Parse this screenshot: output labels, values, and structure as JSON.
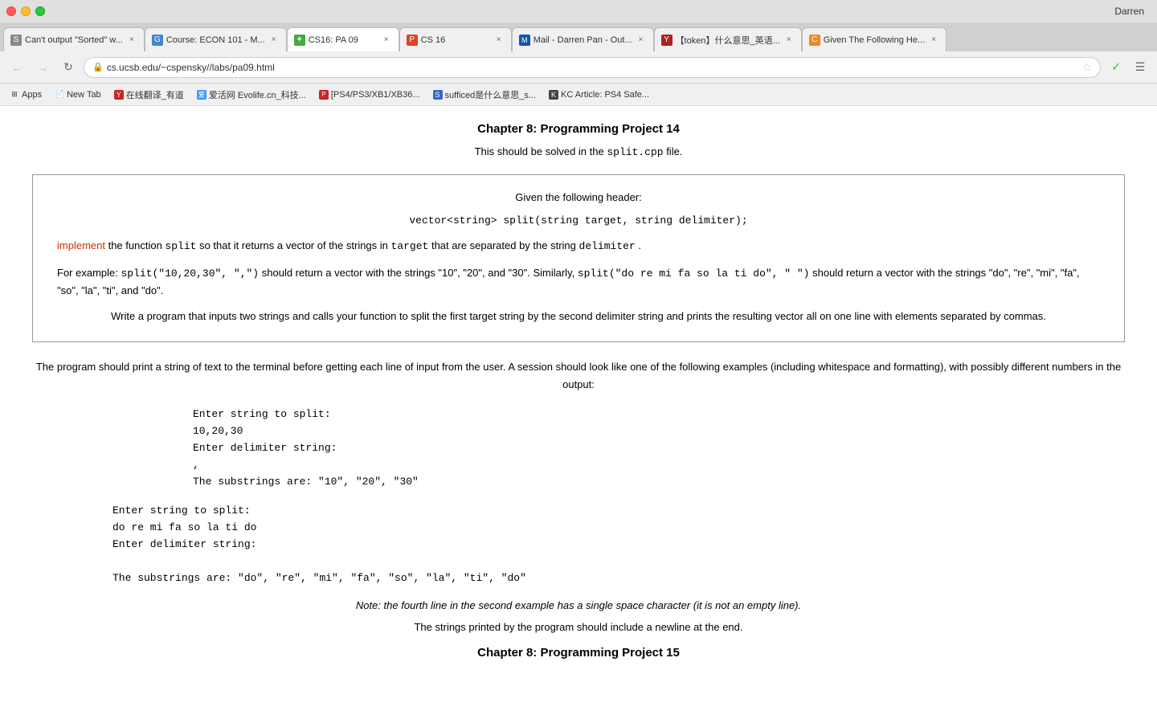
{
  "browser": {
    "user": "Darren",
    "tabs": [
      {
        "id": "tab1",
        "title": "Can't output \"Sorted\" w...",
        "favicon_color": "#888",
        "favicon_char": "S",
        "active": false
      },
      {
        "id": "tab2",
        "title": "Course: ECON 101 - M...",
        "favicon_color": "#4488cc",
        "favicon_char": "G",
        "active": false
      },
      {
        "id": "tab3",
        "title": "CS16: PA 09",
        "favicon_color": "#44aa44",
        "favicon_char": "✦",
        "active": true
      },
      {
        "id": "tab4",
        "title": "CS 16",
        "favicon_color": "#dd4422",
        "favicon_char": "P",
        "active": false
      },
      {
        "id": "tab5",
        "title": "Mail - Darren Pan - Out...",
        "favicon_color": "#1155aa",
        "favicon_char": "M",
        "active": false
      },
      {
        "id": "tab6",
        "title": "【token】什么意思_英语...",
        "favicon_color": "#aa2222",
        "favicon_char": "Y",
        "active": false
      },
      {
        "id": "tab7",
        "title": "Given The Following He...",
        "favicon_color": "#ee8822",
        "favicon_char": "C",
        "active": false
      }
    ],
    "address": "cs.ucsb.edu/~cspensky//labs/pa09.html",
    "bookmarks": [
      {
        "label": "Apps",
        "favicon_char": "",
        "favicon_color": "#888"
      },
      {
        "label": "New Tab",
        "favicon_char": "📄",
        "favicon_color": "#fff"
      },
      {
        "label": "在线翻译_有道",
        "favicon_char": "Y",
        "favicon_color": "#cc2222"
      },
      {
        "label": "爱活网 Evolife.cn_科技...",
        "favicon_char": "A",
        "favicon_color": "#3399ff"
      },
      {
        "label": "[PS4/PS3/XB1/XB36...",
        "favicon_char": "P",
        "favicon_color": "#cc2222"
      },
      {
        "label": "sufficed是什么意思_s...",
        "favicon_char": "S",
        "favicon_color": "#3366cc"
      },
      {
        "label": "KC Article: PS4 Safe...",
        "favicon_char": "K",
        "favicon_color": "#444"
      }
    ]
  },
  "page": {
    "title1": "Chapter 8: Programming Project 14",
    "subtitle": "This should be solved in the",
    "subtitle_code": "split.cpp",
    "subtitle_end": "file.",
    "box": {
      "header": "Given the following header:",
      "code_signature": "vector<string>  split(string target, string delimiter);",
      "impl_text_before": "implement the function",
      "impl_code": "split",
      "impl_text_after": "so that it returns a vector of the strings in",
      "impl_target": "target",
      "impl_text2": "that are separated by the string",
      "impl_delimiter": "delimiter",
      "impl_end": ".",
      "example_text": "For example:",
      "example_call": "split(\"10,20,30\", \",\")",
      "example_mid": "should return a vector with the strings \"10\", \"20\", and \"30\". Similarly,",
      "example_call2": "split(\"do re mi fa so la ti do\", \" \")",
      "example_mid2": "should return a vector with the strings \"do\", \"re\", \"mi\", \"fa\", \"so\", \"la\", \"ti\", and \"do\".",
      "write_text": "Write a program that inputs two strings and calls your function to split the first target string by the second delimiter string and prints the resulting vector all on one line with elements separated by commas."
    },
    "program_desc": "The program should print a string of text to the terminal before getting each line of input from the user. A session should look like one of the following examples (including whitespace and formatting), with possibly different numbers in the output:",
    "example1": {
      "line1": "Enter string to split:",
      "line2": "10,20,30",
      "line3": "Enter delimiter string:",
      "line4": ",",
      "line5": "The substrings are: \"10\", \"20\", \"30\""
    },
    "example2": {
      "line1": "Enter string to split:",
      "line2": "do re mi fa so la ti do",
      "line3": "Enter delimiter string:",
      "line4": "",
      "line5": "The substrings are: \"do\", \"re\", \"mi\", \"fa\", \"so\", \"la\", \"ti\", \"do\""
    },
    "note": "Note: the fourth line in the second example has a single space character (it is not an empty line).",
    "strings_note": "The strings printed by the program should include a newline at the end.",
    "title2": "Chapter 8: Programming Project 15"
  }
}
